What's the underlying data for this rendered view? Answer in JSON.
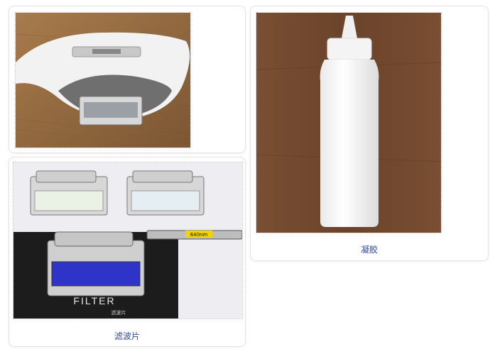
{
  "gallery": {
    "items": [
      {
        "caption": "",
        "image_alt": "handheld device head"
      },
      {
        "caption": "凝胶",
        "image_alt": "white gel bottle"
      },
      {
        "caption": "滤波片",
        "image_alt": "filters",
        "label_tag": "640nm",
        "box_text": "FILTER",
        "box_subtext": "滤波片"
      }
    ]
  },
  "colors": {
    "caption": "#2a4aa8",
    "card_border": "#e3e3e3"
  }
}
